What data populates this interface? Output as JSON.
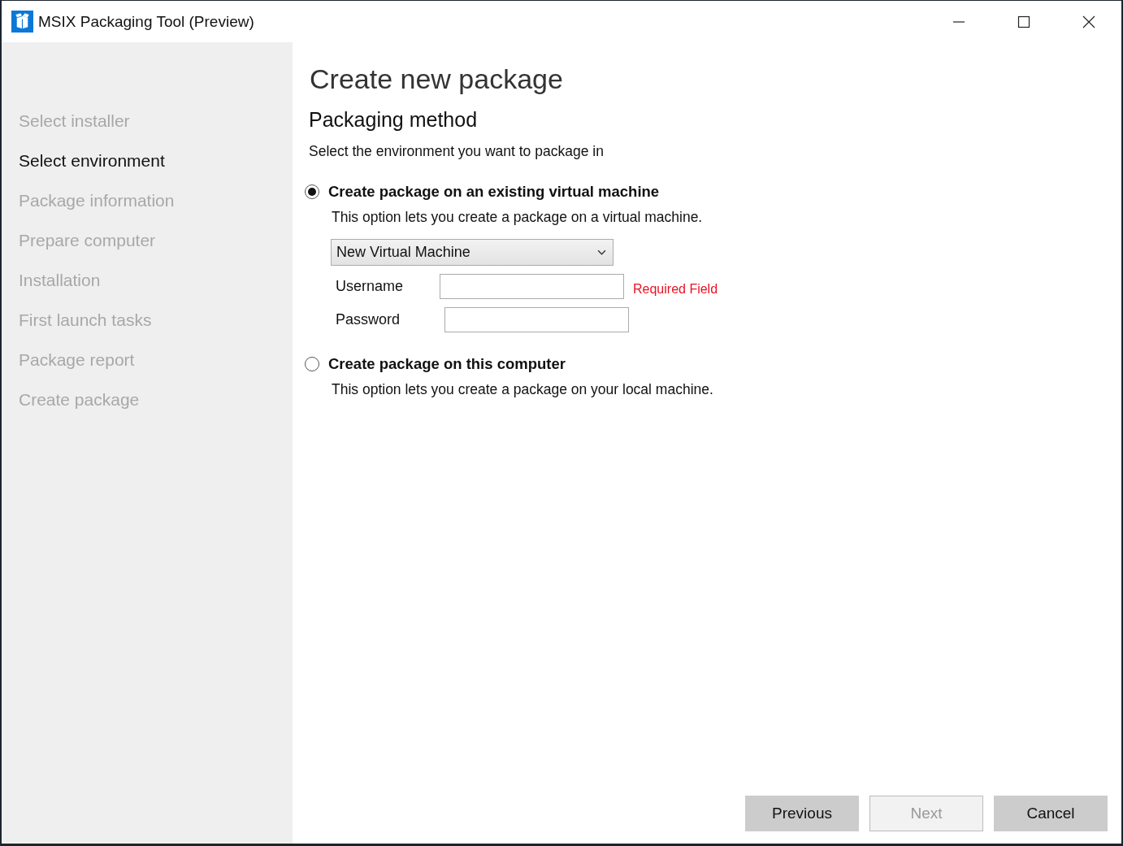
{
  "window": {
    "title": "MSIX Packaging Tool (Preview)"
  },
  "sidebar": {
    "items": [
      {
        "label": "Select installer",
        "selected": false
      },
      {
        "label": "Select environment",
        "selected": true
      },
      {
        "label": "Package information",
        "selected": false
      },
      {
        "label": "Prepare computer",
        "selected": false
      },
      {
        "label": "Installation",
        "selected": false
      },
      {
        "label": "First launch tasks",
        "selected": false
      },
      {
        "label": "Package report",
        "selected": false
      },
      {
        "label": "Create package",
        "selected": false
      }
    ]
  },
  "page": {
    "title": "Create new package",
    "subtitle": "Packaging method",
    "instruction": "Select the environment you want to package in",
    "options": [
      {
        "label": "Create package on an existing virtual machine",
        "description": "This option lets you create a package on a virtual machine.",
        "selected": true,
        "dropdown": {
          "value": "New Virtual Machine"
        },
        "fields": [
          {
            "label": "Username",
            "error": "Required Field"
          },
          {
            "label": "Password"
          }
        ]
      },
      {
        "label": "Create package on this computer",
        "description": "This option lets you create a package on your local machine.",
        "selected": false
      }
    ]
  },
  "buttons": [
    {
      "label": "Previous",
      "disabled": false
    },
    {
      "label": "Next",
      "disabled": true
    },
    {
      "label": "Cancel",
      "disabled": false
    }
  ]
}
